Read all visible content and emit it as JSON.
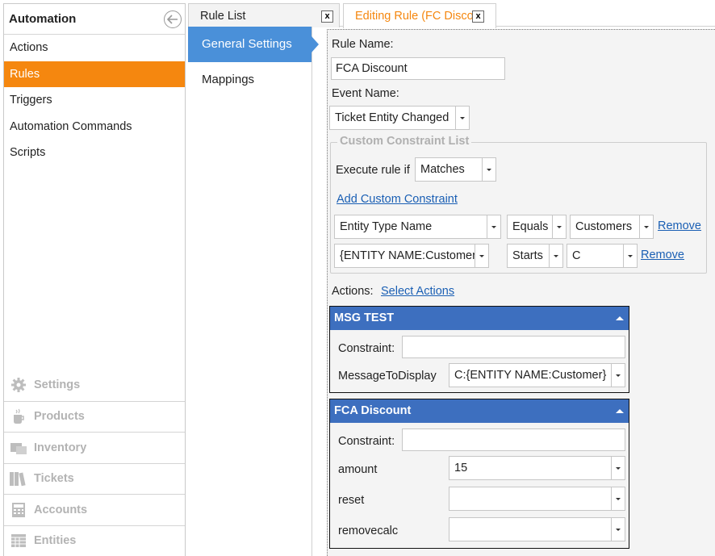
{
  "sidebar": {
    "title": "Automation",
    "items": [
      {
        "label": "Actions"
      },
      {
        "label": "Rules"
      },
      {
        "label": "Triggers"
      },
      {
        "label": "Automation Commands"
      },
      {
        "label": "Scripts"
      }
    ],
    "categories": [
      {
        "label": "Settings",
        "icon": "gear-icon"
      },
      {
        "label": "Products",
        "icon": "cup-icon"
      },
      {
        "label": "Inventory",
        "icon": "inventory-icon"
      },
      {
        "label": "Tickets",
        "icon": "books-icon"
      },
      {
        "label": "Accounts",
        "icon": "calculator-icon"
      },
      {
        "label": "Entities",
        "icon": "table-icon"
      }
    ]
  },
  "tabs": [
    {
      "label": "Rule List"
    },
    {
      "label": "Editing Rule (FC Disco"
    }
  ],
  "nav": {
    "items": [
      {
        "label": "General Settings"
      },
      {
        "label": "Mappings"
      }
    ]
  },
  "form": {
    "rule_name_label": "Rule Name:",
    "rule_name_value": "FCA Discount",
    "event_name_label": "Event Name:",
    "event_name_value": "Ticket Entity Changed",
    "constraint_list_title": "Custom Constraint List",
    "execute_label": "Execute rule if",
    "execute_value": "Matches",
    "add_constraint_link": "Add Custom Constraint",
    "constraints": [
      {
        "field": "Entity Type Name",
        "operator": "Equals",
        "value": "Customers",
        "remove": "Remove"
      },
      {
        "field": "{ENTITY NAME:Customer}",
        "operator": "Starts",
        "value": "C",
        "remove": "Remove"
      }
    ],
    "actions_label": "Actions:",
    "select_actions_link": "Select Actions"
  },
  "actions": [
    {
      "title": "MSG TEST",
      "constraint_label": "Constraint:",
      "constraint_value": "",
      "params": [
        {
          "label": "MessageToDisplay",
          "value": "C:{ENTITY NAME:Customer}"
        }
      ]
    },
    {
      "title": "FCA Discount",
      "constraint_label": "Constraint:",
      "constraint_value": "",
      "params": [
        {
          "label": "amount",
          "value": "15"
        },
        {
          "label": "reset",
          "value": ""
        },
        {
          "label": "removecalc",
          "value": ""
        }
      ]
    }
  ],
  "colors": {
    "accent_orange": "#f5870f",
    "nav_blue": "#4a90d9",
    "panel_blue": "#3d6fbf",
    "link_blue": "#1a5fb4"
  }
}
